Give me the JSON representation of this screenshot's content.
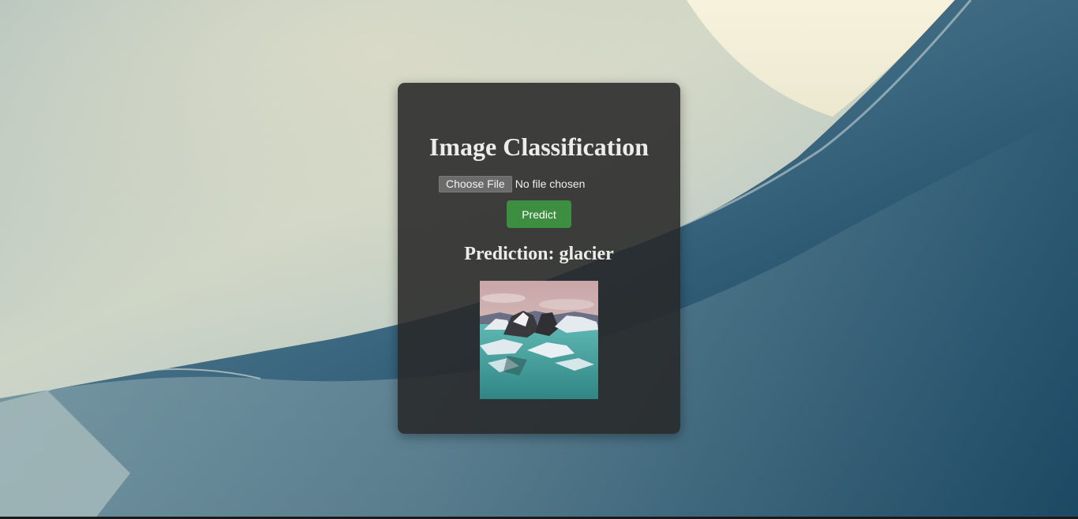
{
  "page": {
    "title": "Image Classification"
  },
  "upload": {
    "choose_label": "Choose File",
    "status": "No file chosen"
  },
  "actions": {
    "predict_label": "Predict"
  },
  "result": {
    "text": "Prediction: glacier"
  },
  "colors": {
    "card_bg": "#282828",
    "predict_button": "#3e8e41",
    "heading_text": "#ececec",
    "file_button": "#6b6b6b"
  },
  "icons": {
    "preview": "glacier-photo"
  }
}
